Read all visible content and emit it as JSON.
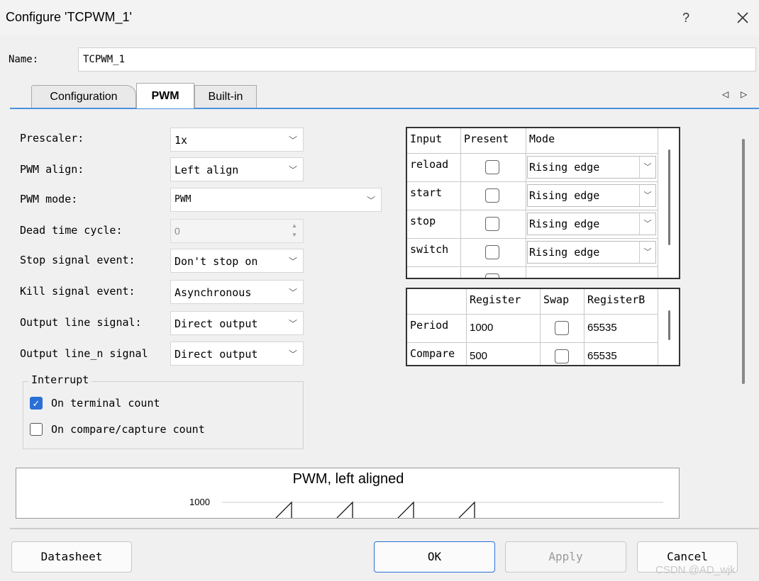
{
  "window": {
    "title": "Configure 'TCPWM_1'",
    "help": "?",
    "close": "✕"
  },
  "name": {
    "label": "Name:",
    "value": "TCPWM_1"
  },
  "tabs": {
    "configuration": "Configuration",
    "pwm": "PWM",
    "builtin": "Built-in",
    "active": "PWM",
    "scroll_left": "◁",
    "scroll_right": "▷"
  },
  "form": {
    "prescaler": {
      "label": "Prescaler:",
      "value": "1x"
    },
    "pwm_align": {
      "label": "PWM align:",
      "value": "Left align"
    },
    "pwm_mode": {
      "label": "PWM mode:",
      "value": "PWM"
    },
    "dead_time": {
      "label": "Dead time cycle:",
      "value": "0"
    },
    "stop_signal": {
      "label": "Stop signal event:",
      "value": "Don't stop on"
    },
    "kill_signal": {
      "label": "Kill signal event:",
      "value": "Asynchronous"
    },
    "output_line": {
      "label": "Output line signal:",
      "value": "Direct output"
    },
    "output_line_n": {
      "label": "Output line_n signal",
      "value": "Direct output"
    },
    "chevron": "﹀"
  },
  "interrupt": {
    "legend": "Interrupt",
    "terminal": {
      "label": "On terminal count",
      "checked": true,
      "mark": "✓"
    },
    "compare": {
      "label": "On compare/capture count",
      "checked": false
    }
  },
  "inputs_table": {
    "headers": [
      "Input",
      "Present",
      "Mode"
    ],
    "rows": [
      {
        "input": "reload",
        "present": false,
        "mode": "Rising edge"
      },
      {
        "input": "start",
        "present": false,
        "mode": "Rising edge"
      },
      {
        "input": "stop",
        "present": false,
        "mode": "Rising edge"
      },
      {
        "input": "switch",
        "present": false,
        "mode": "Rising edge"
      }
    ]
  },
  "registers_table": {
    "headers": [
      "",
      "Register",
      "Swap",
      "RegisterB"
    ],
    "rows": [
      {
        "name": "Period",
        "register": "1000",
        "swap": false,
        "register_b": "65535"
      },
      {
        "name": "Compare",
        "register": "500",
        "swap": false,
        "register_b": "65535"
      }
    ]
  },
  "chart": {
    "title": "PWM, left aligned",
    "y_tick": "1000"
  },
  "buttons": {
    "datasheet": "Datasheet",
    "ok": "OK",
    "apply": "Apply",
    "cancel": "Cancel"
  },
  "watermark": "CSDN @AD_wjk"
}
